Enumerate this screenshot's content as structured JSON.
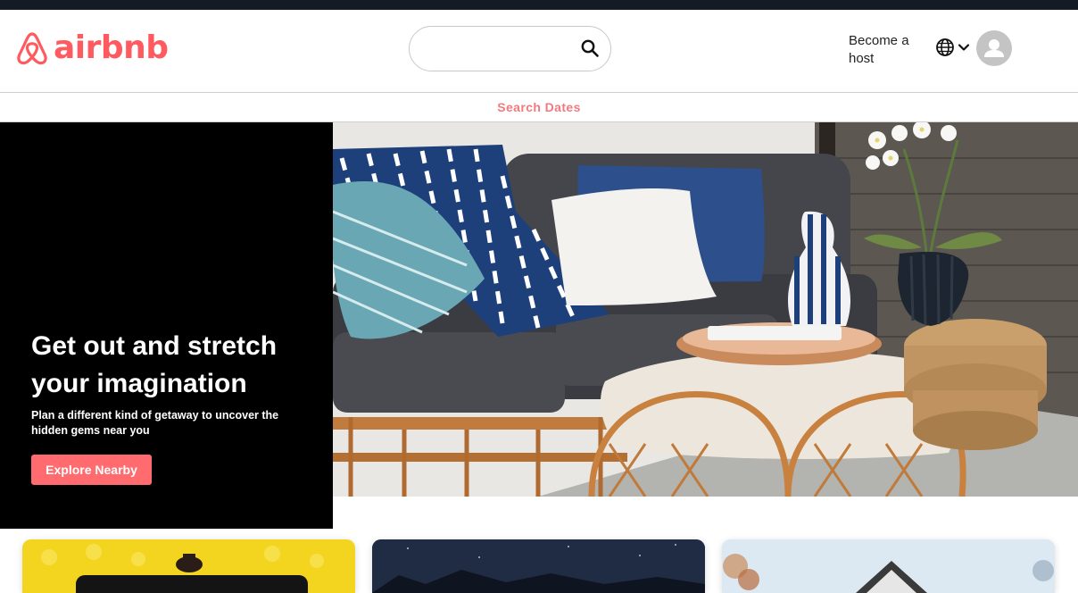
{
  "brand": {
    "name": "airbnb",
    "color": "#ff5a5f"
  },
  "header": {
    "search": {
      "value": "",
      "placeholder": ""
    },
    "host_link": "Become a host",
    "icons": {
      "search": "search-icon",
      "language": "globe-icon",
      "dropdown": "chevron-down-icon",
      "user": "user-avatar-icon"
    }
  },
  "subnav": {
    "search_dates": "Search Dates"
  },
  "hero": {
    "title": "Get out and stretch your imagination",
    "subtitle": "Plan a different kind of getaway to uncover the hidden gems near you",
    "button_label": "Explore Nearby",
    "button_color": "#ff6b6e"
  },
  "cards": [
    {
      "name": "card-1"
    },
    {
      "name": "card-2"
    },
    {
      "name": "card-3"
    }
  ]
}
